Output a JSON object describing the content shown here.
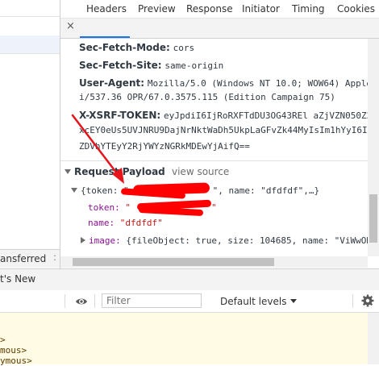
{
  "left_panel": {
    "bottom_tab_label": "ansferred",
    "bottom_dot": ":"
  },
  "tabs": [
    {
      "label": "Headers",
      "active": true
    },
    {
      "label": "Preview",
      "active": false
    },
    {
      "label": "Response",
      "active": false
    },
    {
      "label": "Initiator",
      "active": false
    },
    {
      "label": "Timing",
      "active": false
    },
    {
      "label": "Cookies",
      "active": false
    }
  ],
  "close_symbol": "×",
  "headers": {
    "sec_fetch_mode": {
      "name": "Sec-Fetch-Mode:",
      "value": "cors"
    },
    "sec_fetch_site": {
      "name": "Sec-Fetch-Site:",
      "value": "same-origin"
    },
    "user_agent": {
      "name": "User-Agent:",
      "value": "Mozilla/5.0 (Windows NT 10.0; WOW64) AppleWe",
      "value_cont": "i/537.36 OPR/67.0.3575.115 (Edition Campaign 75)"
    },
    "xsrf": {
      "name": "X-XSRF-TOKEN:",
      "value": "eyJpdiI6IjRoRXFTdDU3OG43REl aZjVZN050Z2c9",
      "value_cont1": "xcEY0eUs5UVJNRU9DajNrNktWaDh5UkpLaGFvZk44MyIsIm1hYyI6I",
      "value_cont2": "ZDVhYTEyY2RjYWYzNGRkMDEwYjAifQ=="
    }
  },
  "payload": {
    "title": "Request Payload",
    "view_source": "view source",
    "summary_prefix": "{token: \"",
    "summary_suffix": "\", name: \"dfdfdf\",…}",
    "token_key": "token:",
    "token_value_open": "\"",
    "token_value_close": "\"",
    "name_key": "name:",
    "name_value": "\"dfdfdf\"",
    "image_key": "image:",
    "image_value": "{fileObject: true, size: 104685, name: \"ViWwOD"
  },
  "drawer": {
    "tab_label": "t's New"
  },
  "console": {
    "filter_placeholder": "Filter",
    "levels_label": "Default levels",
    "lines": [
      ">",
      "mous>",
      "ymous>"
    ]
  },
  "colors": {
    "accent": "#1a73e8",
    "redaction": "#ff0000",
    "annotation_arrow": "#e8141c",
    "console_warning_bg": "#fffbe5"
  }
}
